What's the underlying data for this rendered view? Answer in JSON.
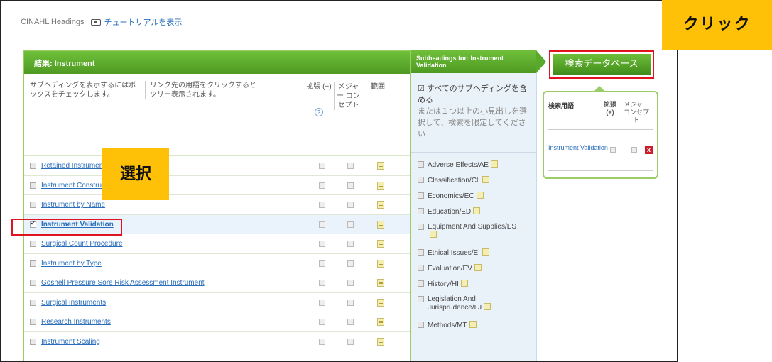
{
  "topbar": {
    "title": "CINAHL Headings",
    "tutorial": "チュートリアルを表示"
  },
  "main": {
    "header_title": "結果: Instrument",
    "col_hint_a": "サブヘディングを表示するにはボックスをチェックします。",
    "col_hint_b": "リンク先の用語をクリックするとツリー表示されます。",
    "col_expand": "拡張 (+)",
    "col_major": "メジャー コンセプト",
    "col_scope": "範囲",
    "help_icon": "?",
    "rows": [
      {
        "label": "Retained Instruments",
        "checked": false
      },
      {
        "label": "Instrument Construction",
        "checked": false
      },
      {
        "label": "Instrument by Name",
        "checked": false
      },
      {
        "label": "Instrument Validation",
        "checked": true
      },
      {
        "label": "Surgical Count Procedure",
        "checked": false
      },
      {
        "label": "Instrument by Type",
        "checked": false
      },
      {
        "label": "Gosnell Pressure Sore Risk Assessment Instrument",
        "checked": false
      },
      {
        "label": "Surgical Instruments",
        "checked": false
      },
      {
        "label": "Research Instruments",
        "checked": false
      },
      {
        "label": "Instrument Scaling",
        "checked": false
      }
    ]
  },
  "subheadings": {
    "header_title": "Subheadings for: Instrument Validation",
    "include_all": "すべてのサブヘディングを含める",
    "hint": "または１つ以上の小見出しを選択して、検索を限定してください",
    "items": [
      "Adverse Effects/AE",
      "Classification/CL",
      "Economics/EC",
      "Education/ED",
      "Equipment And Supplies/ES",
      "Ethical Issues/EI",
      "Evaluation/EV",
      "History/HI",
      "Legislation And Jurisprudence/LJ",
      "Methods/MT"
    ]
  },
  "search_button": "検索データベース",
  "builder": {
    "col_term": "検索用語",
    "col_expand": "拡張 (+)",
    "col_major": "メジャー コンセプト",
    "term": "Instrument Validation",
    "delete_icon": "x"
  },
  "callouts": {
    "click": "クリック",
    "select": "選択"
  },
  "colors": {
    "accent_green": "#5aa82c",
    "highlight_red": "#e0141e",
    "callout_yellow": "#ffc107",
    "link_blue": "#2a6ebb"
  }
}
